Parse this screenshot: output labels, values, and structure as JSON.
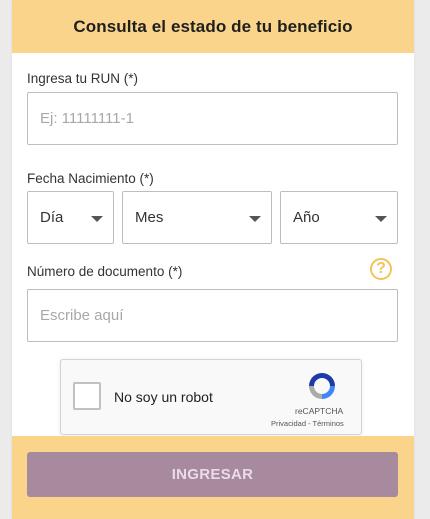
{
  "header": {
    "title": "Consulta el estado de tu beneficio"
  },
  "run_field": {
    "label": "Ingresa tu RUN (*)",
    "placeholder": "Ej: 11111111-1",
    "value": ""
  },
  "birth_date": {
    "label": "Fecha Nacimiento (*)",
    "day": {
      "selected": "Día"
    },
    "month": {
      "selected": "Mes"
    },
    "year": {
      "selected": "Año"
    }
  },
  "document": {
    "label": "Número de documento (*)",
    "placeholder": "Escribe aquí",
    "help_icon": "question-icon"
  },
  "captcha": {
    "label": "No soy un robot",
    "brand": "reCAPTCHA",
    "links": "Privacidad - Términos"
  },
  "submit": {
    "label": "INGRESAR"
  },
  "colors": {
    "accent": "#fad48b",
    "button": "#a88a9f",
    "button_text": "#ebdbe8",
    "help_icon": "#f2c45a"
  }
}
